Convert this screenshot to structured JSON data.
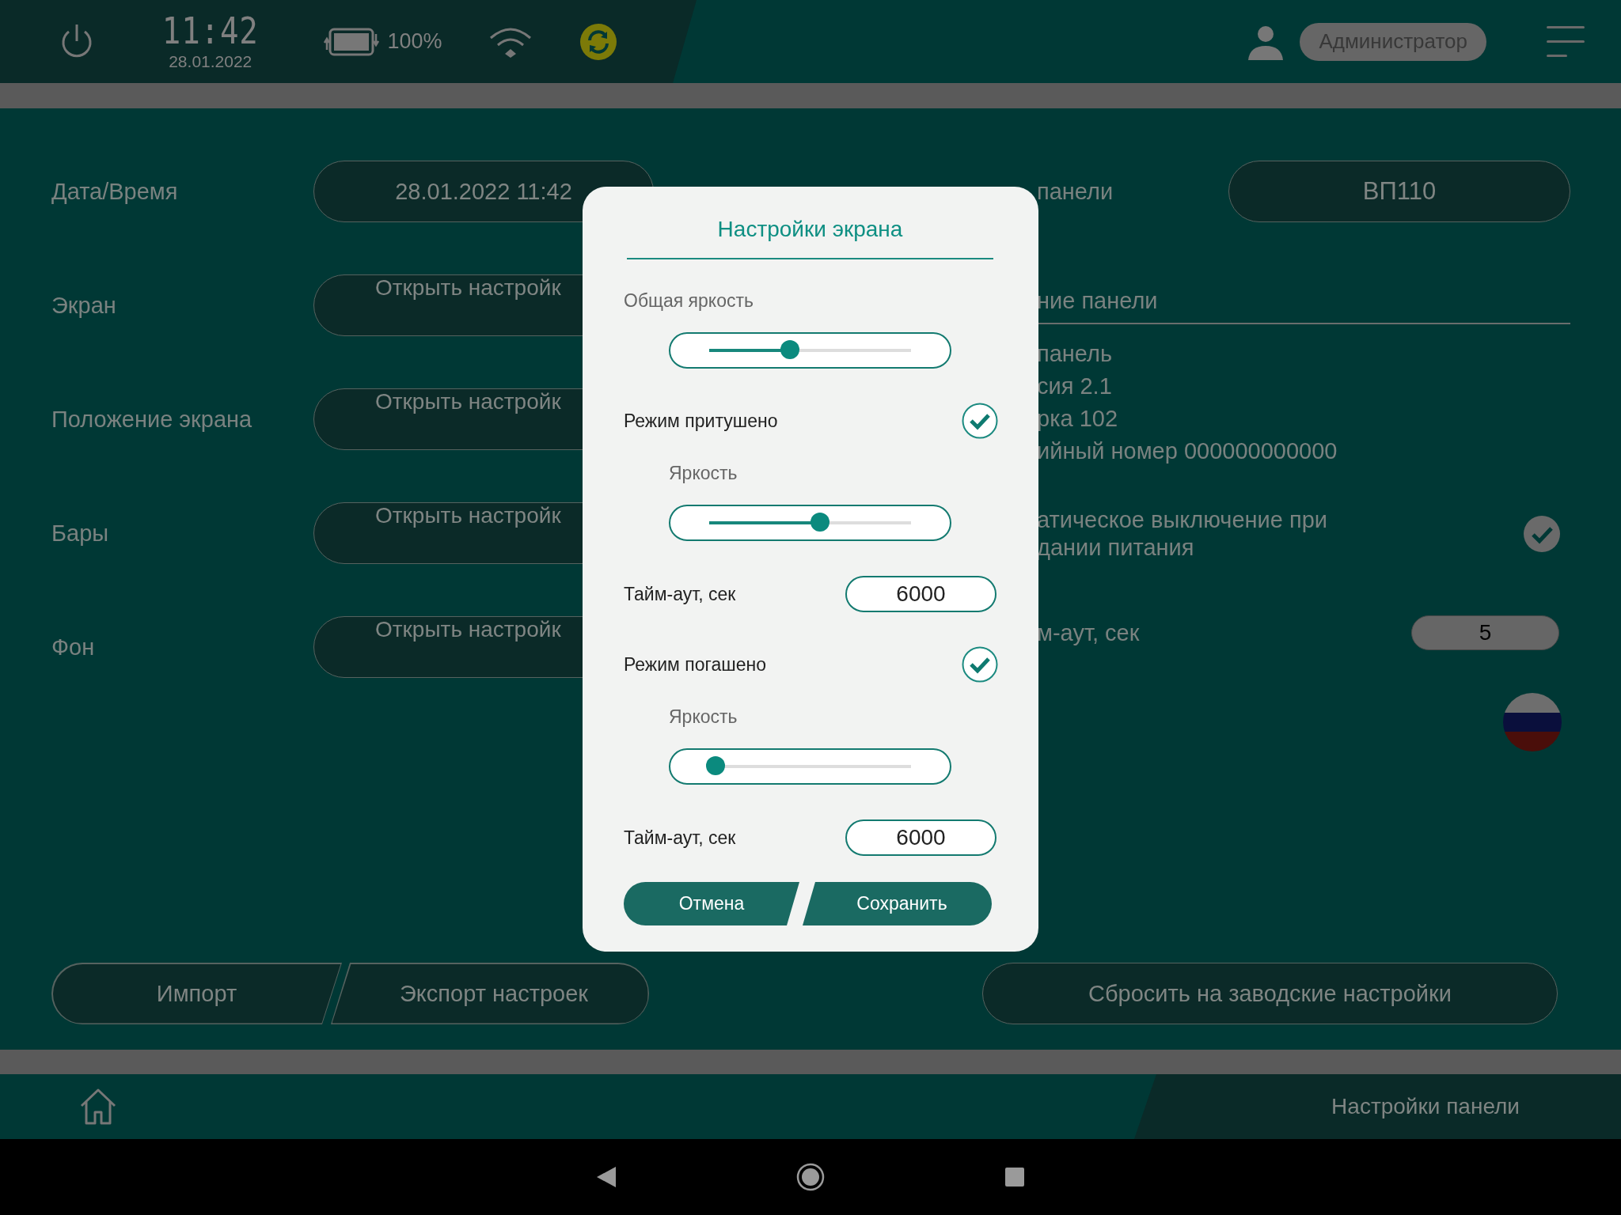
{
  "top_bar": {
    "time": "11:42",
    "date": "28.01.2022",
    "battery": "100%",
    "user": "Администратор"
  },
  "settings": [
    {
      "label": "Дата/Время",
      "button": "28.01.2022 11:42"
    },
    {
      "label": "Экран",
      "button": "Открыть настройк"
    },
    {
      "label": "Положение экрана",
      "button": "Открыть настройк"
    },
    {
      "label": "Бары",
      "button": "Открыть настройк"
    },
    {
      "label": "Фон",
      "button": "Открыть настройк"
    }
  ],
  "panel_name": {
    "label": "панели",
    "value": "ВП110"
  },
  "panel_info": {
    "heading": "ние панели",
    "lines": [
      "панель",
      "сия 2.1",
      "рка 102",
      "ийный номер 000000000000"
    ]
  },
  "auto_off": {
    "label_lines": [
      "атическое выключение при",
      "дании питания"
    ],
    "checked": true
  },
  "timeout": {
    "label": "м-аут, сек",
    "value": "5"
  },
  "actions": [
    "Импорт",
    "Экспорт настроек"
  ],
  "reset": "Сбросить на заводские настройки",
  "footer": {
    "title": "Настройки панели"
  },
  "dialog": {
    "title": "Настройки экрана",
    "items": [
      {
        "kind": "slider",
        "label": "Общая яркость",
        "level": 0.4
      },
      {
        "kind": "toggle",
        "label": "Режим притушено",
        "checked": true,
        "children": [
          {
            "kind": "slider",
            "label": "Яркость",
            "level": 0.55
          }
        ]
      },
      {
        "kind": "field",
        "label": "Тайм-аут, сек",
        "value": "6000"
      },
      {
        "kind": "toggle",
        "label": "Режим погашено",
        "checked": true,
        "children": [
          {
            "kind": "slider",
            "label": "Яркость",
            "level": 0.03
          }
        ]
      },
      {
        "kind": "field",
        "label": "Тайм-аут, сек",
        "value": "6000"
      }
    ],
    "buttons": [
      "Отмена",
      "Сохранить"
    ]
  }
}
